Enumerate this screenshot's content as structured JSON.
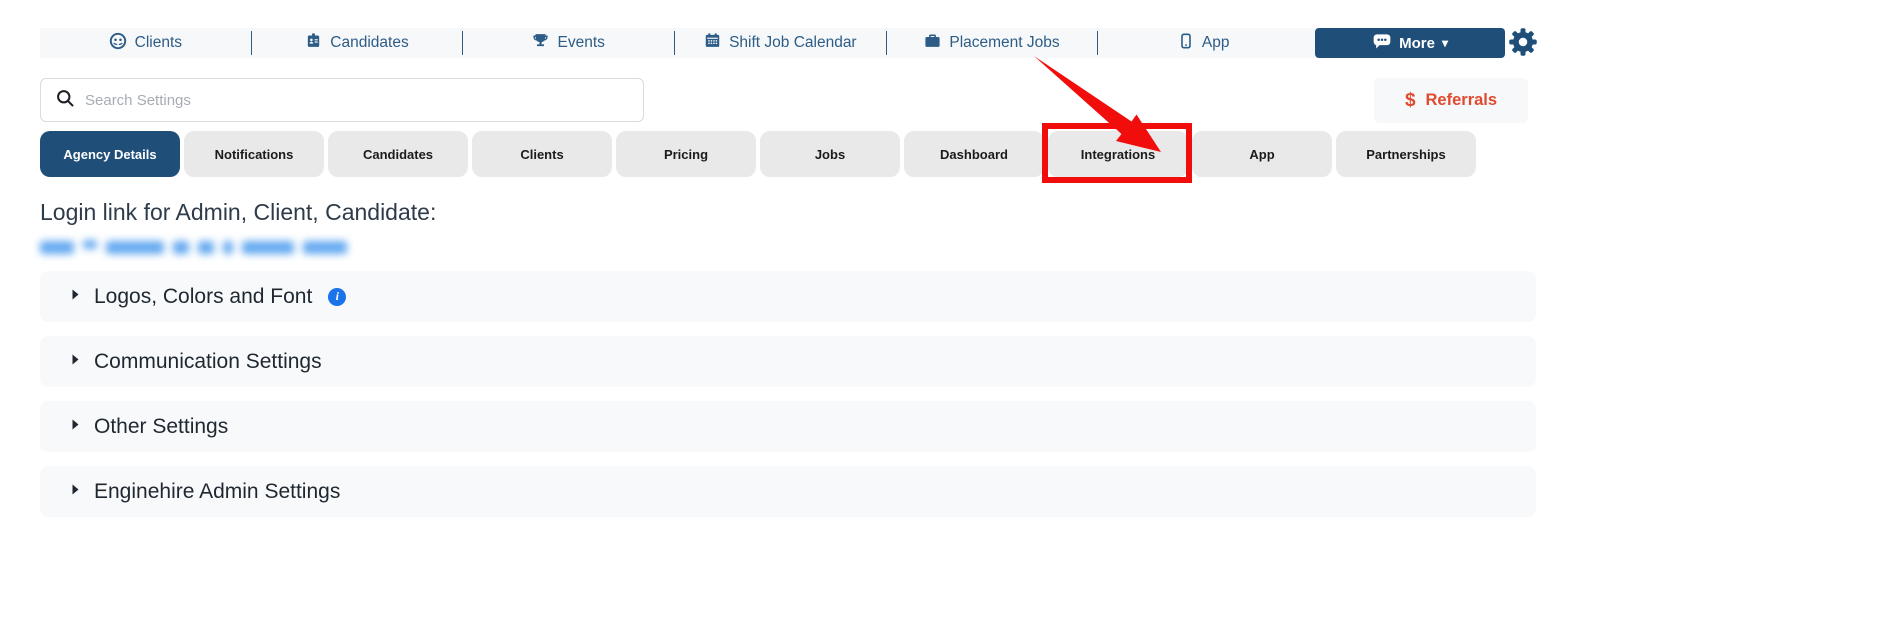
{
  "nav": {
    "items": [
      {
        "label": "Clients"
      },
      {
        "label": "Candidates"
      },
      {
        "label": "Events"
      },
      {
        "label": "Shift Job Calendar"
      },
      {
        "label": "Placement Jobs"
      },
      {
        "label": "App"
      }
    ],
    "more_label": "More",
    "more_caret": "▾"
  },
  "search": {
    "placeholder": "Search Settings"
  },
  "referrals": {
    "label": "Referrals",
    "dollar": "$"
  },
  "tabs": [
    {
      "label": "Agency Details",
      "active": true
    },
    {
      "label": "Notifications"
    },
    {
      "label": "Candidates"
    },
    {
      "label": "Clients"
    },
    {
      "label": "Pricing"
    },
    {
      "label": "Jobs"
    },
    {
      "label": "Dashboard"
    },
    {
      "label": "Integrations",
      "highlighted": true
    },
    {
      "label": "App"
    },
    {
      "label": "Partnerships"
    }
  ],
  "content": {
    "login_link_heading": "Login link for Admin, Client, Candidate:",
    "login_link_redacted": true,
    "sections": [
      {
        "label": "Logos, Colors and Font",
        "has_info_icon": true,
        "info_glyph": "i"
      },
      {
        "label": "Communication Settings"
      },
      {
        "label": "Other Settings"
      },
      {
        "label": "Enginehire Admin Settings"
      }
    ]
  },
  "colors": {
    "accent_navy": "#1f4e78",
    "nav_link": "#2d5c86",
    "referral_orange": "#e04a2e",
    "annotation_red": "#f20d0d",
    "info_blue": "#1a73e8",
    "section_bg": "#f8f9fa",
    "tab_inactive_bg": "#e9e9e9"
  }
}
